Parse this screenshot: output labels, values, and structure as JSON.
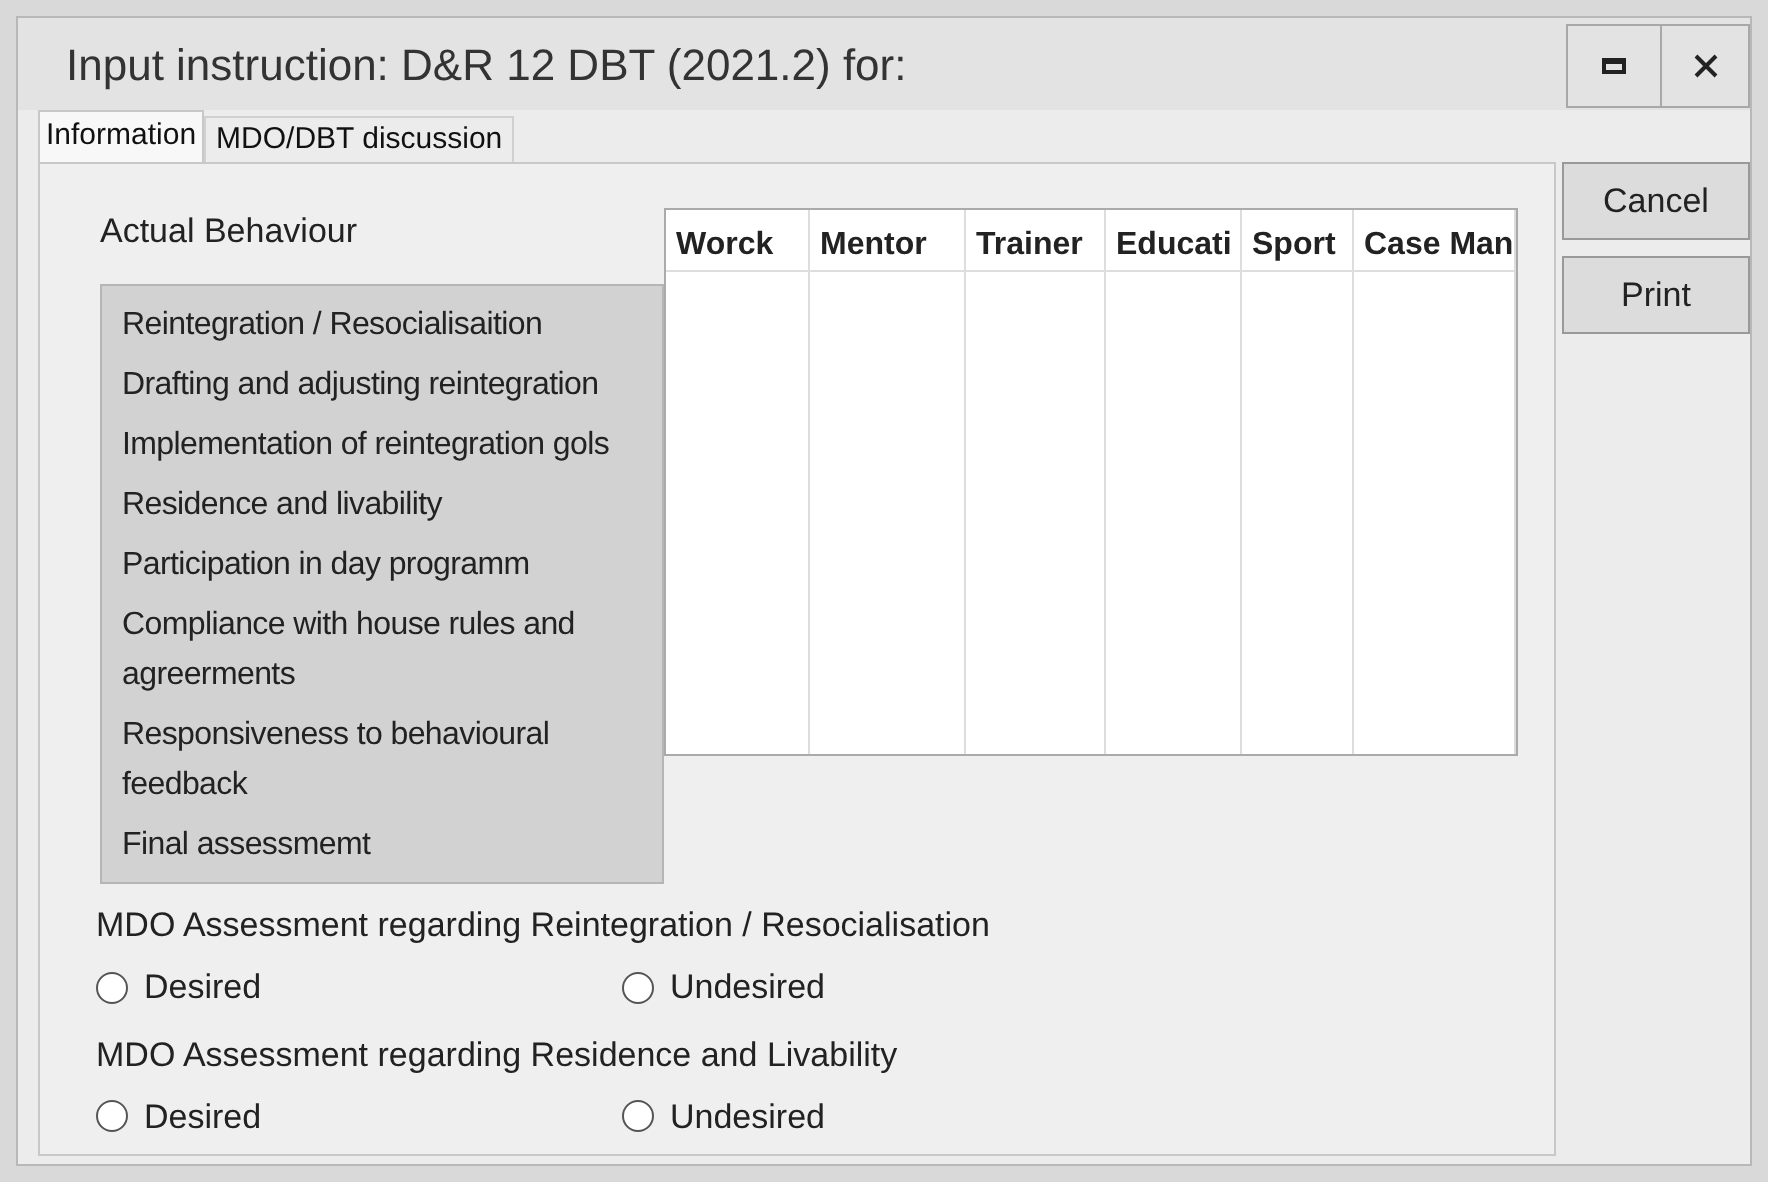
{
  "window": {
    "title": "Input instruction: D&R 12 DBT (2021.2) for:"
  },
  "tabs": [
    {
      "label": "Information",
      "selected": true
    },
    {
      "label": "MDO/DBT discussion",
      "selected": false
    }
  ],
  "section_label": "Actual Behaviour",
  "behaviour_list": [
    "Reintegration / Resocialisaition",
    "Drafting and adjusting reintegration",
    "Implementation of reintegration gols",
    "Residence and livability",
    "Participation in day programm",
    "Compliance with house rules and agreerments",
    "Responsiveness to behavioural feedback",
    "Final assessmemt"
  ],
  "table": {
    "columns": [
      "Worck",
      "Mentor",
      "Trainer",
      "Educati",
      "Sport",
      "Case Man"
    ]
  },
  "assessments": [
    {
      "label": "MDO Assessment regarding Reintegration / Resocialisation",
      "options": [
        {
          "label": "Desired",
          "selected": false
        },
        {
          "label": "Undesired",
          "selected": false
        }
      ]
    },
    {
      "label": "MDO Assessment regarding Residence and Livability",
      "options": [
        {
          "label": "Desired",
          "selected": false
        },
        {
          "label": "Undesired",
          "selected": false
        }
      ]
    }
  ],
  "buttons": [
    "Cancel",
    "Print"
  ]
}
